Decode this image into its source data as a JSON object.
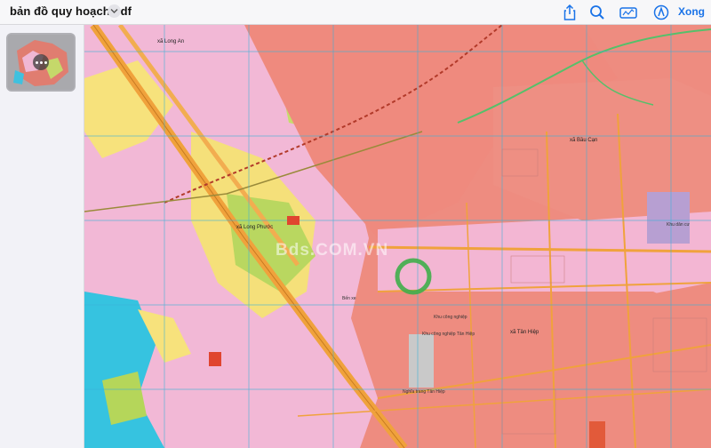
{
  "window": {
    "title": "bản đồ quy hoạch.pdf",
    "done_label": "Xong"
  },
  "toolbar": {
    "icons": [
      "share-icon",
      "search-icon",
      "markup-icon",
      "annotate-icon"
    ]
  },
  "sidebar": {
    "thumbnail_count": 1
  },
  "map": {
    "watermark": "Bds.COM.VN",
    "labels": {
      "long_an": "xã Long An",
      "bau_can": "xã Bầu Cạn",
      "long_phuoc": "xã Long Phước",
      "tan_hiep": "xã Tân Hiệp",
      "tan_hiep_sport": "Nghĩa trang Tân Hiệp",
      "zone_a": "Khu công nghiệp",
      "zone_b": "Khu dân cư",
      "zone_c": "Bến xe",
      "zone_d": "Khu công nghiệp Tân Hiệp"
    },
    "colors": {
      "red_zone": "#ee8c80",
      "pink_zone": "#f2b8d6",
      "yellow_zone": "#f7e57a",
      "green_zone": "#b5d65a",
      "cyan_water": "#36c3e0",
      "road": "#f0a23c",
      "grid_line": "#3ab0d8"
    }
  }
}
